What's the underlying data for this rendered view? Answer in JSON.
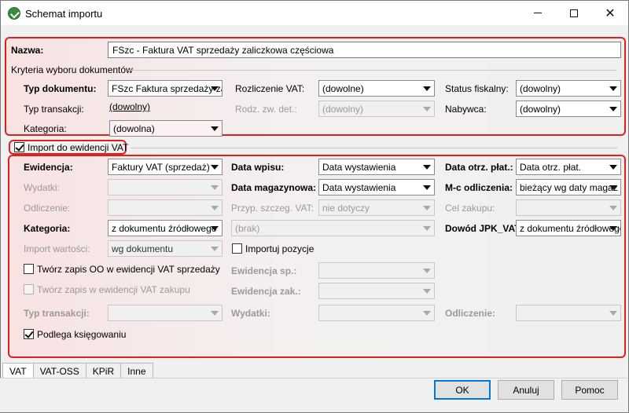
{
  "window": {
    "title": "Schemat importu"
  },
  "name_label": "Nazwa:",
  "name_value": "FSzc - Faktura VAT sprzedaży zaliczkowa częściowa",
  "criteria_header": "Kryteria wyboru dokumentów",
  "criteria": {
    "typ_dokumentu": {
      "label": "Typ dokumentu:",
      "value": "FSzc Faktura sprzedaży zal"
    },
    "typ_transakcji": {
      "label": "Typ transakcji:",
      "value": "(dowolny)"
    },
    "kategoria": {
      "label": "Kategoria:",
      "value": "(dowolna)"
    },
    "rozliczenie_vat": {
      "label": "Rozliczenie VAT:",
      "value": "(dowolne)"
    },
    "rodz_zw_det": {
      "label": "Rodz. zw. det.:",
      "value": "(dowolny)"
    },
    "status_fiskalny": {
      "label": "Status fiskalny:",
      "value": "(dowolny)"
    },
    "nabywca": {
      "label": "Nabywca:",
      "value": "(dowolny)"
    }
  },
  "import_checkbox": {
    "label": "Import do ewidencji VAT",
    "checked": true
  },
  "vat": {
    "ewidencja": {
      "label": "Ewidencja:",
      "value": "Faktury VAT (sprzedaż)"
    },
    "wydatki": {
      "label": "Wydatki:",
      "value": ""
    },
    "odliczenie": {
      "label": "Odliczenie:",
      "value": ""
    },
    "kategoria": {
      "label": "Kategoria:",
      "value": "z dokumentu źródłowego"
    },
    "import_wartosci": {
      "label": "Import wartości:",
      "value": "wg dokumentu"
    },
    "data_wpisu": {
      "label": "Data wpisu:",
      "value": "Data wystawienia"
    },
    "data_magazynowa": {
      "label": "Data magazynowa:",
      "value": "Data wystawienia"
    },
    "przyp_szczeg_vat": {
      "label": "Przyp. szczeg. VAT:",
      "value": "nie dotyczy"
    },
    "brak": {
      "value": "(brak)"
    },
    "importuj_pozycje": {
      "label": "Importuj pozycje",
      "checked": false
    },
    "data_otrz_plat": {
      "label": "Data otrz. płat.:",
      "value": "Data otrz. płat."
    },
    "mc_odliczenia": {
      "label": "M-c odliczenia:",
      "value": "bieżący wg daty magaz"
    },
    "cel_zakupu": {
      "label": "Cel zakupu:",
      "value": ""
    },
    "dowod_jpk": {
      "label": "Dowód JPK_VAT:",
      "value": "z dokumentu źródłowego"
    },
    "tworz_oo": {
      "label": "Twórz zapis OO w ewidencji VAT sprzedaży",
      "checked": false
    },
    "tworz_zakup": {
      "label": "Twórz zapis w ewidencji VAT zakupu",
      "checked": false
    },
    "ewidencja_sp": {
      "label": "Ewidencja sp.:",
      "value": ""
    },
    "ewidencja_zak": {
      "label": "Ewidencja zak.:",
      "value": ""
    },
    "typ_transakcji": {
      "label": "Typ transakcji:",
      "value": ""
    },
    "wydatki2": {
      "label": "Wydatki:",
      "value": ""
    },
    "odliczenie2": {
      "label": "Odliczenie:",
      "value": ""
    },
    "podlega": {
      "label": "Podlega księgowaniu",
      "checked": true
    }
  },
  "tabs": [
    "VAT",
    "VAT-OSS",
    "KPiR",
    "Inne"
  ],
  "buttons": {
    "ok": "OK",
    "anuluj": "Anuluj",
    "pomoc": "Pomoc"
  },
  "colors": {
    "highlight": "#e02020",
    "default_button_border": "#0078d7"
  }
}
